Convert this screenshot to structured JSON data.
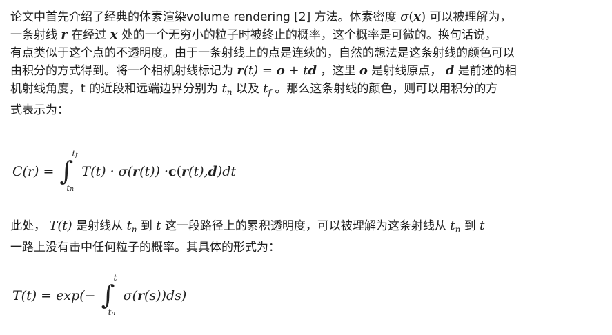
{
  "para1": {
    "line1": {
      "a": "论文中首先介绍了经典的体素渲染volume rendering [2] 方法。体素密度 ",
      "sigma": "σ",
      "paren_open": "(",
      "x": "x",
      "paren_close": ")",
      "b": " 可以被理解为，"
    },
    "line2": {
      "a": "一条射线 ",
      "r": "r",
      "b": " 在经过 ",
      "x": "x",
      "c": " 处的一个无穷小的粒子时被终止的概率，这个概率是可微的。换句话说，"
    },
    "line3": {
      "a": "有点类似于这个点的不透明度。由于一条射线上的点是连续的，自然的想法是这条射线的颜色可以"
    },
    "line4": {
      "a": "由积分的方式得到。将一个相机射线标记为 ",
      "r": "r",
      "t1": "(t)",
      "eq": " = ",
      "o": "o",
      "plus": " + ",
      "t2": "t",
      "d": "d",
      "b": " ，这里 ",
      "o2": "o",
      "c": " 是射线原点， ",
      "d2": "d",
      "e": " 是前述的相"
    },
    "line5": {
      "a": "机射线角度，t 的近段和远端边界分别为 ",
      "tn_t": "t",
      "tn_sub": "n",
      "b": " 以及 ",
      "tf_t": "t",
      "tf_sub": "f",
      "c": " 。那么这条射线的颜色，则可以用积分的方"
    },
    "line6": {
      "a": "式表示为："
    }
  },
  "eq1": {
    "lhs": "C(r) = ",
    "int_sign": "∫",
    "upper": "t",
    "upper_sub": "f",
    "lower": "t",
    "lower_sub": "n",
    "T": "T(t) · σ(",
    "r": "r",
    "t": "(t)) · ",
    "c": "c",
    "open": "(",
    "r2": "r",
    "mid": "(t), ",
    "d": "d",
    "end": ")dt"
  },
  "para2": {
    "line1": {
      "a": "此处， ",
      "Tt": "T(t)",
      "b": " 是射线从 ",
      "tn_t": "t",
      "tn_sub": "n",
      "c": " 到 ",
      "t": "t",
      "d": " 这一段路径上的累积透明度，可以被理解为这条射线从 ",
      "tn2_t": "t",
      "tn2_sub": "n",
      "e": " 到 ",
      "t2": "t"
    },
    "line2": {
      "a": "一路上没有击中任何粒子的概率。其具体的形式为："
    }
  },
  "eq2": {
    "lhs": "T(t) = exp(−",
    "int_sign": "∫",
    "upper": "t",
    "lower": "t",
    "lower_sub": "n",
    "sigma": "σ(",
    "r": "r",
    "end": "(s))ds)"
  }
}
